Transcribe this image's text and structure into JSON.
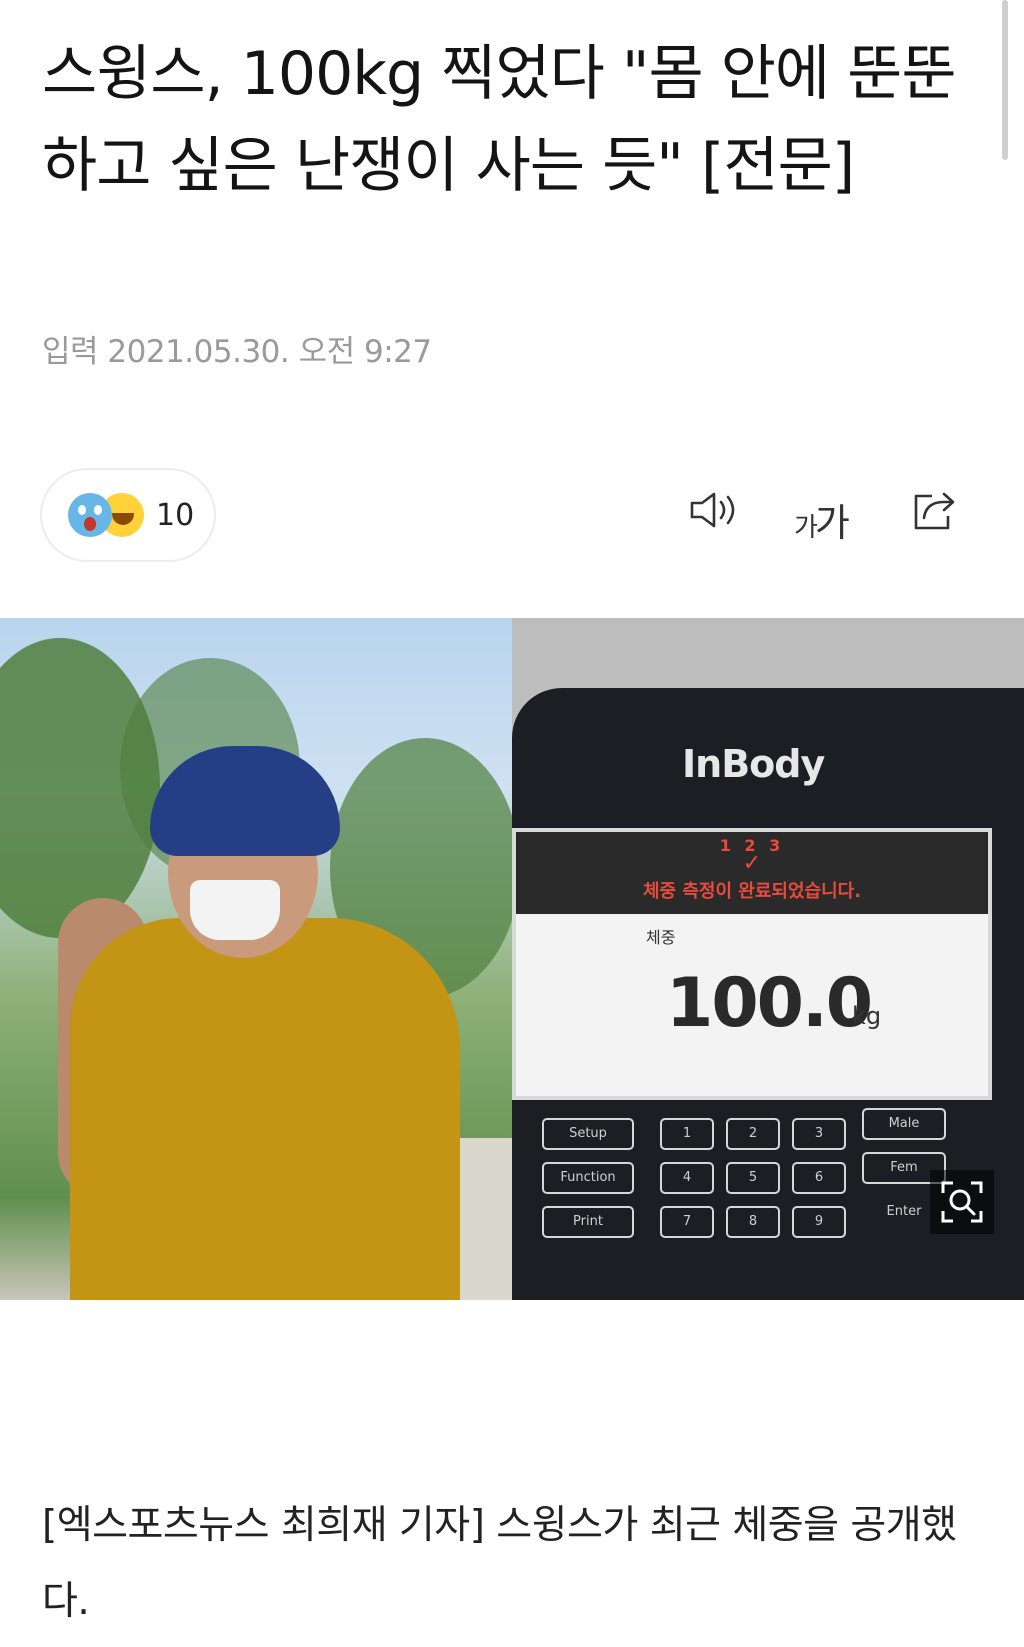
{
  "article": {
    "title": "스윙스, 100kg 찍었다 \"몸 안에 뚠뚠하고 싶은 난쟁이 사는 듯\" [전문]",
    "date": "입력 2021.05.30. 오전 9:27",
    "body": "[엑스포츠뉴스 최희재 기자] 스윙스가 최근 체중을 공개했다."
  },
  "reactions": {
    "icons": [
      "shocked-emoji-icon",
      "laughing-emoji-icon"
    ],
    "count": "10"
  },
  "toolbar": {
    "icons": [
      "speaker-icon",
      "font-size-icon",
      "share-icon"
    ],
    "font_size_label_small": "가",
    "font_size_label_large": "가"
  },
  "photo": {
    "scale_brand": "InBody",
    "scale_steps": "1 2 3",
    "scale_message": "체중 측정이 완료되었습니다.",
    "scale_weight_label": "체중",
    "scale_weight_value": "100.0",
    "scale_weight_unit": "kg",
    "keys": [
      "Setup",
      "1",
      "2",
      "3",
      "Male",
      "Function",
      "4",
      "5",
      "6",
      "Fem",
      "Print",
      "7",
      "8",
      "9",
      "Enter"
    ],
    "zoom_icon": "magnify-icon"
  },
  "colors": {
    "title": "#141414",
    "meta": "#9a9a9a",
    "accent_red": "#e84b3c"
  }
}
